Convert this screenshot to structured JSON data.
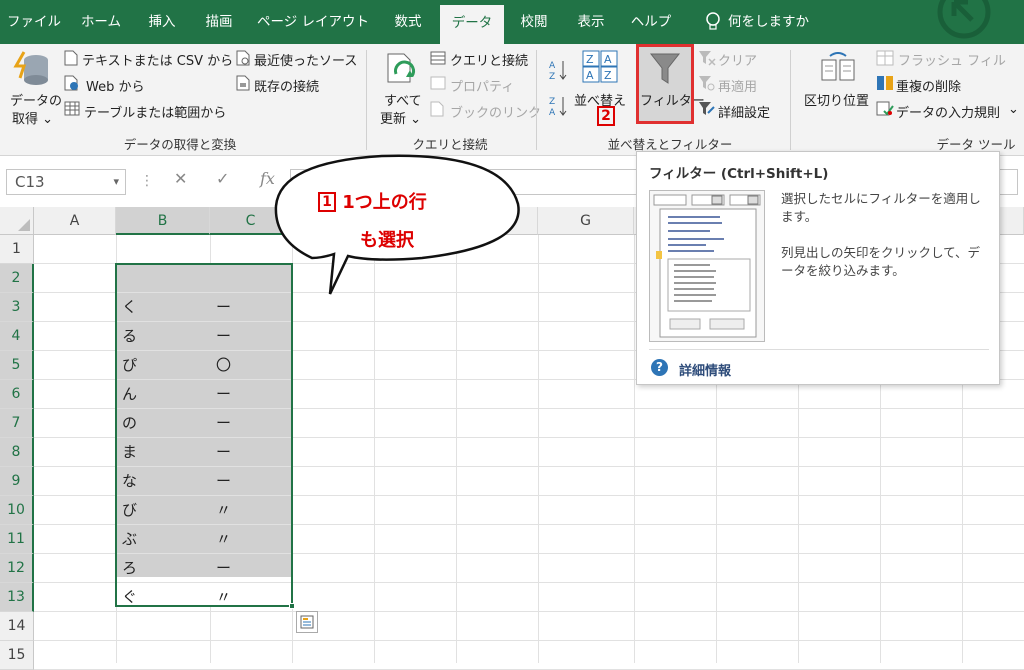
{
  "tabs": [
    "ファイル",
    "ホーム",
    "挿入",
    "描画",
    "ページ レイアウト",
    "数式",
    "データ",
    "校閲",
    "表示",
    "ヘルプ",
    "何をしますか"
  ],
  "active_tab": "データ",
  "ribbon": {
    "get_data": {
      "label1": "データの",
      "label2": "取得 ⌄"
    },
    "from_text_csv": "テキストまたは CSV から",
    "from_web": "Web から",
    "from_table": "テーブルまたは範囲から",
    "recent_sources": "最近使ったソース",
    "existing_connections": "既存の接続",
    "group_get_transform": "データの取得と変換",
    "refresh_all1": "すべて",
    "refresh_all2": "更新 ⌄",
    "queries_connections": "クエリと接続",
    "properties": "プロパティ",
    "edit_links": "ブックのリンク",
    "group_queries": "クエリと接続",
    "sort": "並べ替え",
    "filter": "フィルター",
    "clear": "クリア",
    "reapply": "再適用",
    "advanced": "詳細設定",
    "group_sort_filter": "並べ替えとフィルター",
    "text_to_columns": "区切り位置",
    "flash_fill": "フラッシュ フィル",
    "remove_duplicates": "重複の削除",
    "data_validation": "データの入力規則",
    "data_validation_arrow": "⌄",
    "group_data_tools": "データ ツール"
  },
  "formula_bar": {
    "name_box": "C13",
    "name_box_arrow": "▾",
    "dots": "⋮",
    "cancel": "✕",
    "enter": "✓",
    "fx": "fx"
  },
  "columns": [
    "A",
    "B",
    "C",
    "D",
    "E",
    "F",
    "G"
  ],
  "rows": [
    "1",
    "2",
    "3",
    "4",
    "5",
    "6",
    "7",
    "8",
    "9",
    "10",
    "11",
    "12",
    "13",
    "14",
    "15"
  ],
  "cells_b": [
    "",
    "",
    "く",
    "る",
    "ぴ",
    "ん",
    "の",
    "ま",
    "な",
    "び",
    "ぶ",
    "ろ",
    "ぐ",
    "",
    ""
  ],
  "cells_c": [
    "",
    "",
    "ー",
    "ー",
    "〇",
    "ー",
    "ー",
    "ー",
    "ー",
    "〃",
    "〃",
    "ー",
    "〃",
    "",
    ""
  ],
  "tooltip": {
    "title": "フィルター (Ctrl+Shift+L)",
    "desc1": "選択したセルにフィルターを適用します。",
    "desc2": "列見出しの矢印をクリックして、データを絞り込みます。",
    "help": "詳細情報"
  },
  "callout": {
    "step_num": "1",
    "line1": "1つ上の行",
    "line2": "も選択"
  },
  "step2_num": "2",
  "colors": {
    "excel_green": "#217346",
    "highlight_red": "#e03030",
    "selection_gray": "#d0d0d0"
  }
}
